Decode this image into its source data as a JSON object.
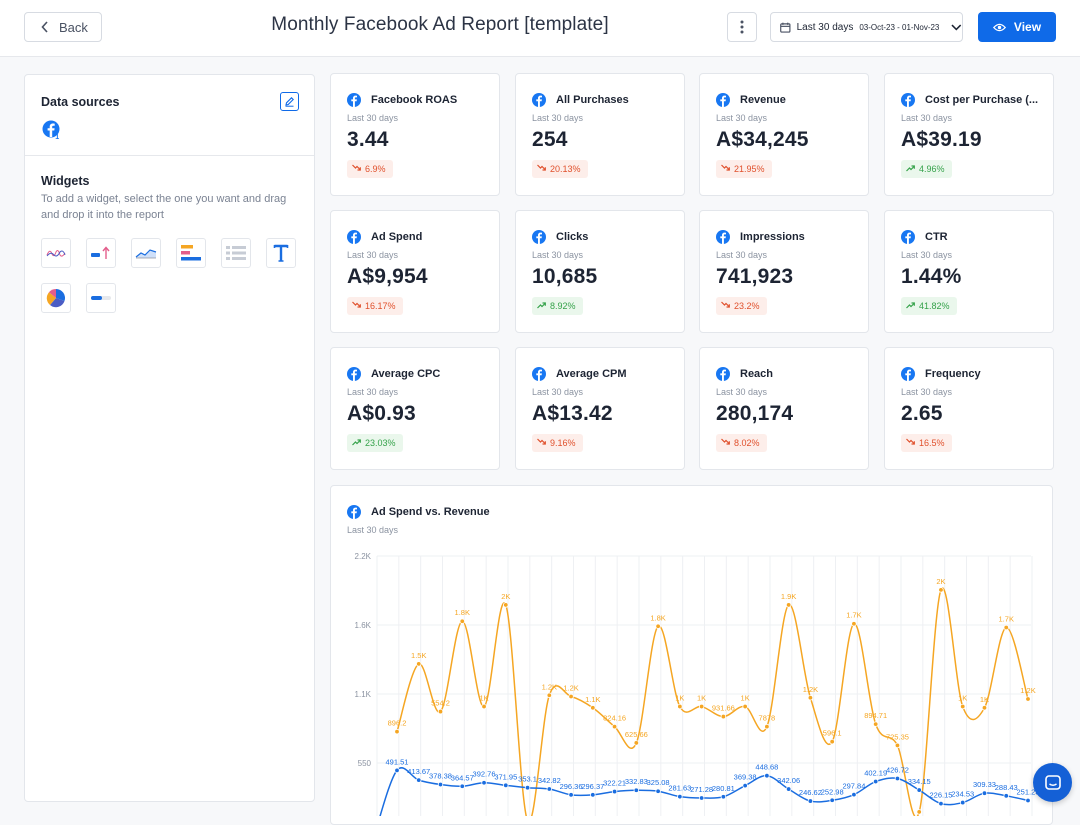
{
  "header": {
    "back_label": "Back",
    "title": "Monthly Facebook Ad Report [template]",
    "date_label": "Last 30 days",
    "date_range": "03-Oct-23 - 01-Nov-23",
    "view_label": "View"
  },
  "sidebar": {
    "data_sources_title": "Data sources",
    "source_badge": "1",
    "widgets_title": "Widgets",
    "widgets_description": "To add a widget, select the one you want and drag and drop it into the report",
    "widgets": [
      "line-chart-icon",
      "bar-arrow-icon",
      "area-chart-icon",
      "horizontal-bar-icon",
      "table-icon",
      "text-icon",
      "pie-chart-icon",
      "progress-bar-icon"
    ]
  },
  "colors": {
    "accent": "#0f6ae8",
    "revenue": "#f5a623",
    "spend": "#1a6de0",
    "down": "#e0502c",
    "up": "#35a24a"
  },
  "metrics": [
    {
      "title": "Facebook ROAS",
      "period": "Last 30 days",
      "value": "3.44",
      "change": "6.9%",
      "dir": "down"
    },
    {
      "title": "All Purchases",
      "period": "Last 30 days",
      "value": "254",
      "change": "20.13%",
      "dir": "down"
    },
    {
      "title": "Revenue",
      "period": "Last 30 days",
      "value": "A$34,245",
      "change": "21.95%",
      "dir": "down"
    },
    {
      "title": "Cost per Purchase (...",
      "period": "Last 30 days",
      "value": "A$39.19",
      "change": "4.96%",
      "dir": "up"
    },
    {
      "title": "Ad Spend",
      "period": "Last 30 days",
      "value": "A$9,954",
      "change": "16.17%",
      "dir": "down"
    },
    {
      "title": "Clicks",
      "period": "Last 30 days",
      "value": "10,685",
      "change": "8.92%",
      "dir": "up"
    },
    {
      "title": "Impressions",
      "period": "Last 30 days",
      "value": "741,923",
      "change": "23.2%",
      "dir": "down"
    },
    {
      "title": "CTR",
      "period": "Last 30 days",
      "value": "1.44%",
      "change": "41.82%",
      "dir": "up"
    },
    {
      "title": "Average CPC",
      "period": "Last 30 days",
      "value": "A$0.93",
      "change": "23.03%",
      "dir": "up"
    },
    {
      "title": "Average CPM",
      "period": "Last 30 days",
      "value": "A$13.42",
      "change": "9.16%",
      "dir": "down"
    },
    {
      "title": "Reach",
      "period": "Last 30 days",
      "value": "280,174",
      "change": "8.02%",
      "dir": "down"
    },
    {
      "title": "Frequency",
      "period": "Last 30 days",
      "value": "2.65",
      "change": "16.5%",
      "dir": "down"
    }
  ],
  "chart": {
    "title": "Ad Spend vs. Revenue",
    "period": "Last 30 days"
  },
  "chart_data": {
    "type": "line",
    "title": "Ad Spend vs. Revenue",
    "y_ticks": [
      "2.2K",
      "1.6K",
      "1.1K",
      "550"
    ],
    "ylim": [
      0,
      2200
    ],
    "grid": true,
    "series": [
      {
        "values": [
          800,
          1340,
          960,
          1680,
          1000,
          1810,
          90,
          1090,
          1080,
          990,
          840,
          710,
          1640,
          1000,
          1000,
          920,
          1000,
          840,
          1810,
          1070,
          720,
          1660,
          860,
          690,
          160,
          1930,
          1000,
          990,
          1630,
          1060
        ],
        "labels": [
          "896.2",
          "1.5K",
          "554.2",
          "1.8K",
          "1K",
          "2K",
          "",
          "1.2K",
          "1.2K",
          "1.1K",
          "824.16",
          "625.66",
          "1.8K",
          "1K",
          "1K",
          "931.66",
          "1K",
          "7878",
          "1.9K",
          "1.2K",
          "596.1",
          "1.7K",
          "894.71",
          "725.35",
          "",
          "2K",
          "1K",
          "1K",
          "1.7K",
          "1.2K"
        ]
      },
      {
        "values": [
          0,
          491.51,
          413.67,
          378.3,
          364.57,
          392.76,
          371.95,
          353.1,
          342.82,
          296.36,
          296.37,
          322.21,
          332.83,
          325.08,
          281.63,
          271.28,
          280.81,
          369.38,
          448.68,
          342.06,
          246.6,
          252.98,
          297.84,
          402.19,
          426.72,
          334.15,
          226.15,
          234.53,
          309.31,
          288.43,
          251.25
        ],
        "labels": [
          "",
          "491.51",
          "413.67",
          "378.38",
          "364.57",
          "392.76",
          "371.95",
          "353.1",
          "342.82",
          "296.36",
          "296.37",
          "322.21",
          "332.83",
          "325.08",
          "281.63",
          "271.28",
          "280.81",
          "369.38",
          "448.68",
          "342.06",
          "246.62",
          "252.98",
          "297.84",
          "402.19",
          "426.72",
          "334.15",
          "226.15",
          "234.53",
          "309.33",
          "288.43",
          "251.25"
        ]
      }
    ]
  }
}
